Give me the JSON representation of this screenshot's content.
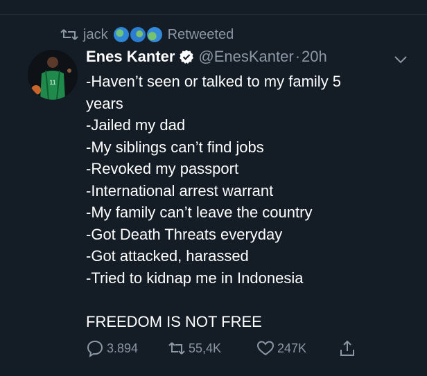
{
  "retweet_context": {
    "user": "jack",
    "label": "Retweeted",
    "emoji_icons": [
      "globe-americas-icon",
      "globe-asia-icon",
      "globe-europe-icon"
    ]
  },
  "tweet": {
    "display_name": "Enes Kanter",
    "verified": true,
    "handle": "@EnesKanter",
    "separator": "·",
    "time": "20h",
    "lines": [
      "-Haven’t seen or talked to my family 5",
      "years",
      "-Jailed my dad",
      "-My siblings can’t find jobs",
      "-Revoked my passport",
      "-International arrest warrant",
      "-My family can’t leave the country",
      "-Got Death Threats everyday",
      "-Got attacked, harassed",
      "-Tried to kidnap me in Indonesia",
      "",
      "FREEDOM IS NOT FREE"
    ]
  },
  "actions": {
    "replies": "3.894",
    "retweets": "55,4K",
    "likes": "247K"
  },
  "colors": {
    "background": "#141c26",
    "muted": "#8b98a5",
    "text": "#ffffff",
    "verified": "#ffffff"
  }
}
